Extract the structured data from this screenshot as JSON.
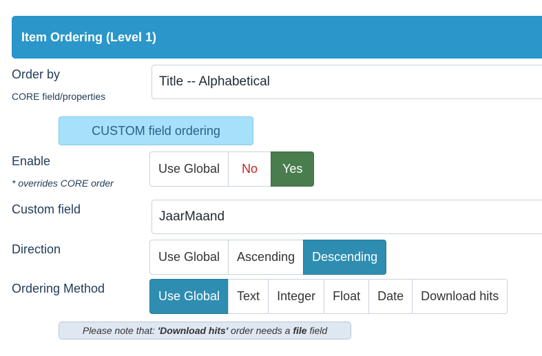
{
  "header": {
    "title": "Item Ordering (Level 1)"
  },
  "order_by": {
    "label": "Order by",
    "sublabel": "CORE field/properties",
    "value": "Title -- Alphabetical"
  },
  "custom_button": {
    "label": "CUSTOM field ordering"
  },
  "enable": {
    "label": "Enable",
    "sublabel": "* overrides CORE order",
    "options": [
      "Use Global",
      "No",
      "Yes"
    ],
    "selected": "Yes"
  },
  "custom_field": {
    "label": "Custom field",
    "value": "JaarMaand"
  },
  "direction": {
    "label": "Direction",
    "options": [
      "Use Global",
      "Ascending",
      "Descending"
    ],
    "selected": "Descending"
  },
  "ordering_method": {
    "label": "Ordering Method",
    "options": [
      "Use Global",
      "Text",
      "Integer",
      "Float",
      "Date",
      "Download hits"
    ],
    "selected": "Use Global"
  },
  "note": {
    "prefix": "Please note that: ",
    "bold1": "'Download hits'",
    "middle": " order needs a ",
    "bold2": "file",
    "suffix": " field"
  },
  "colors": {
    "header": "#2a96c9",
    "custom_button": "#a6e1fb",
    "yes_active": "#4a7d4e",
    "blue_active": "#2e8db1",
    "no_text": "#c0281c"
  }
}
